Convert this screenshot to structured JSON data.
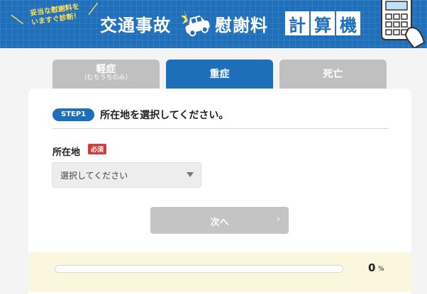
{
  "header": {
    "tagline_line1": "妥当な慰謝料を",
    "tagline_line2": "いますぐ診断！",
    "title_main": "交通事故",
    "title_sub": "慰謝料",
    "title_boxes": [
      "計",
      "算",
      "機"
    ],
    "icons": {
      "car": "car-crash-icon",
      "calculator": "calculator-icon"
    },
    "colors": {
      "banner": "#1f6fba",
      "accent": "#ffe14d"
    }
  },
  "tabs": [
    {
      "label": "軽症",
      "sub": "（むちうちのみ）",
      "active": false
    },
    {
      "label": "重症",
      "sub": "",
      "active": true
    },
    {
      "label": "死亡",
      "sub": "",
      "active": false
    }
  ],
  "form": {
    "step_badge": "STEP1",
    "step_title": "所在地を選択してください。",
    "field_label": "所在地",
    "required_badge": "必須",
    "select_value": "選択してください",
    "next_button": "次へ",
    "next_arrow": "›"
  },
  "progress": {
    "value": "0",
    "unit": "%",
    "fraction": 0
  },
  "colors": {
    "primary": "#1c6fb8",
    "required": "#d43c3c",
    "disabled": "#c4c4c4",
    "progress_bg": "#fbf6de"
  }
}
